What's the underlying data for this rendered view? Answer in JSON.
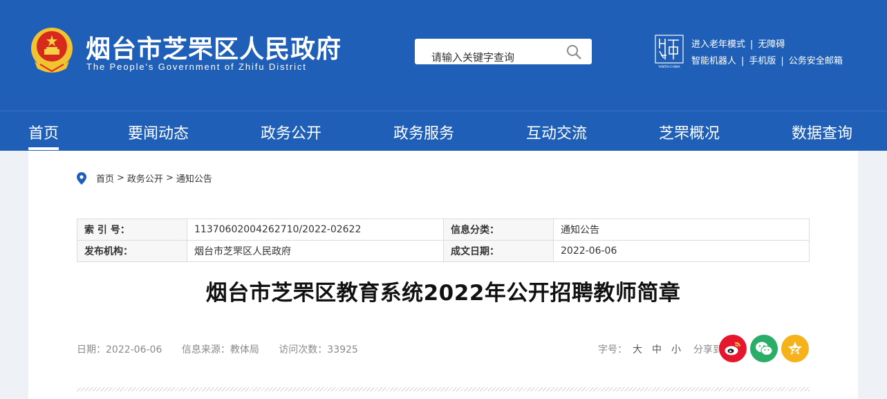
{
  "header": {
    "title": "烟台市芝罘区人民政府",
    "subtitle": "The People's Government of Zhifu District",
    "search_placeholder": "请输入关键字查询",
    "yt_logo_caption": "YANTAI·CHINA",
    "links_row1": [
      "进入老年模式",
      "无障碍"
    ],
    "links_row2": [
      "智能机器人",
      "手机版",
      "公务安全邮箱"
    ]
  },
  "nav": [
    "首页",
    "要闻动态",
    "政务公开",
    "政务服务",
    "互动交流",
    "芝罘概况",
    "数据查询"
  ],
  "breadcrumb": [
    "首页",
    "政务公开",
    "通知公告"
  ],
  "meta": {
    "index_label": "索 引 号：",
    "index_value": "11370602004262710/2022-02622",
    "category_label": "信息分类：",
    "category_value": "通知公告",
    "publisher_label": "发布机构：",
    "publisher_value": "烟台市芝罘区人民政府",
    "date_label": "成文日期：",
    "date_value": "2022-06-06"
  },
  "article": {
    "title": "烟台市芝罘区教育系统2022年公开招聘教师简章",
    "date": "日期：2022-06-06",
    "source": "信息来源：教体局",
    "views": "访问次数：33925"
  },
  "tools": {
    "font_label": "字号：",
    "sizes": [
      "大",
      "中",
      "小"
    ],
    "share_label": "分享到："
  },
  "colors": {
    "brand_blue": "#1f5fb8",
    "weibo": "#e6162d",
    "wechat": "#2aae67",
    "favorite": "#f5b21a"
  }
}
